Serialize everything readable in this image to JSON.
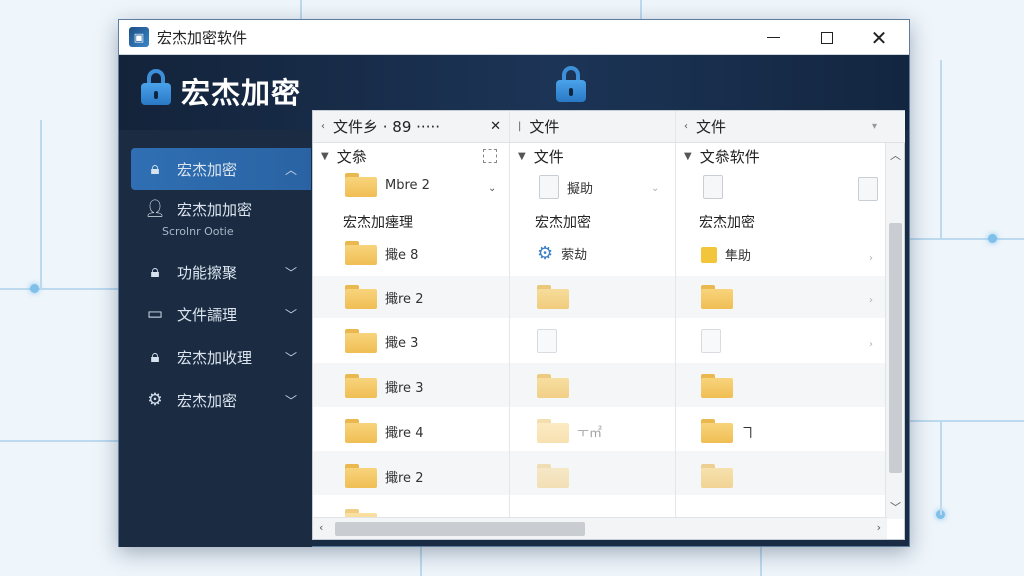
{
  "window": {
    "title": "宏杰加密软件",
    "app_icon": "app-logo-icon"
  },
  "banner": {
    "title": "宏杰加密"
  },
  "sidebar": {
    "items": [
      {
        "label": "宏杰加密",
        "icon": "lock-icon",
        "active": true
      },
      {
        "label": "宏杰加加密",
        "sub": "Scrolnr Ootie",
        "icon": "user-icon"
      },
      {
        "label": "功能擦聚",
        "icon": "lock-icon"
      },
      {
        "label": "文件譳理",
        "icon": "folder-card-icon"
      },
      {
        "label": "宏杰加收理",
        "icon": "lock-icon"
      },
      {
        "label": "宏杰加密",
        "icon": "gear-icon"
      }
    ]
  },
  "columns": [
    {
      "header": "文件乡  ·  89 ·····",
      "sub": "文叅"
    },
    {
      "header": "文件",
      "sub": "文件"
    },
    {
      "header": "文件",
      "sub": "文叅软件"
    }
  ],
  "col1": {
    "top_item": "Mbre 2",
    "section": "宏杰加瘗理",
    "rows": [
      "擑e 8",
      "擑re 2",
      "擑e 3",
      "擑re 3",
      "擑re 4",
      "擑re 2"
    ]
  },
  "col2": {
    "top_item": "擬助",
    "section": "宏杰加密",
    "rows": [
      "萦劫",
      "",
      "",
      "",
      "ㅜ㎡",
      ""
    ]
  },
  "col3": {
    "section": "宏杰加密",
    "rows": [
      "隼助",
      "",
      "",
      "",
      "ヿ",
      ""
    ]
  },
  "colors": {
    "accent": "#2f6fb3",
    "sidebar_bg": "#1a2b42",
    "folder": "#f0be54"
  }
}
